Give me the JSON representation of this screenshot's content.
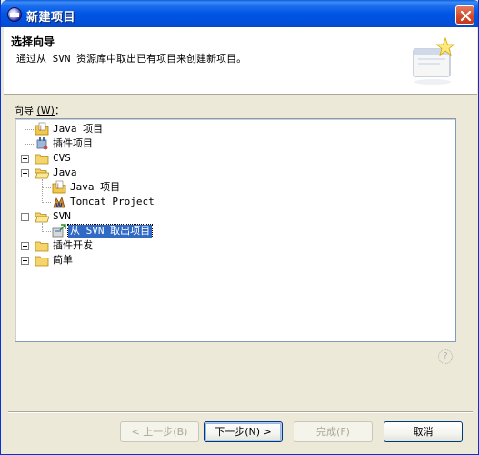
{
  "window": {
    "title": "新建项目"
  },
  "header": {
    "title": "选择向导",
    "description": "通过从 SVN 资源库中取出已有项目来创建新项目。"
  },
  "wizards_label_prefix": "向导",
  "wizards_label_mnemonic": "(W)",
  "wizards_label_suffix": "：",
  "tree": [
    {
      "label": "Java 项目",
      "icon": "java-project-icon"
    },
    {
      "label": "插件项目",
      "icon": "plugin-project-icon"
    },
    {
      "label": "CVS",
      "icon": "folder-icon",
      "expander": "plus"
    },
    {
      "label": "Java",
      "icon": "folder-open-icon",
      "expander": "minus"
    },
    {
      "label": "Java 项目",
      "icon": "java-project-icon"
    },
    {
      "label": "Tomcat Project",
      "icon": "tomcat-icon"
    },
    {
      "label": "SVN",
      "icon": "folder-open-icon",
      "expander": "minus"
    },
    {
      "label": "从 SVN 取出项目",
      "icon": "svn-checkout-icon",
      "selected": true
    },
    {
      "label": "插件开发",
      "icon": "folder-icon",
      "expander": "plus"
    },
    {
      "label": "简单",
      "icon": "folder-icon",
      "expander": "plus"
    }
  ],
  "buttons": {
    "back": "< 上一步(B)",
    "next": "下一步(N) >",
    "finish": "完成(F)",
    "cancel": "取消"
  },
  "help_symbol": "?"
}
